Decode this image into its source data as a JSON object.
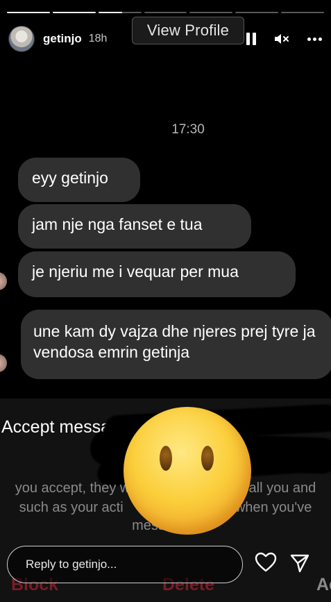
{
  "story": {
    "progress_segments": [
      {
        "state": "done"
      },
      {
        "state": "done"
      },
      {
        "state": "active"
      },
      {
        "state": "pending"
      },
      {
        "state": "pending"
      },
      {
        "state": "pending"
      },
      {
        "state": "pending"
      }
    ],
    "active_segment_progress": 0.55
  },
  "header": {
    "username": "getinjo",
    "time_ago": "18h",
    "view_profile_label": "View Profile",
    "icons": [
      "pause-icon",
      "mute-icon",
      "more-icon"
    ]
  },
  "chat": {
    "timestamp": "17:30",
    "messages": [
      "eyy getinjo",
      "jam nje nga fanset e tua",
      "je njeriu me i vequar per mua",
      "une kam dy vajza dhe njeres prej tyre ja vendosa emrin getinja"
    ]
  },
  "request_panel": {
    "title": "Accept messa",
    "info_lines": [
      "you accept, they w",
      "call you and",
      "such as your acti",
      "when you've",
      "messages."
    ],
    "emoji_sticker": "no-mouth-face-emoji"
  },
  "actions": {
    "block_label": "Block",
    "delete_label": "Delete",
    "accept_label": "Ac"
  },
  "reply": {
    "placeholder": "Reply to getinjo..."
  },
  "colors": {
    "background": "#000000",
    "bubble": "#303030",
    "danger": "#7a1c25"
  }
}
